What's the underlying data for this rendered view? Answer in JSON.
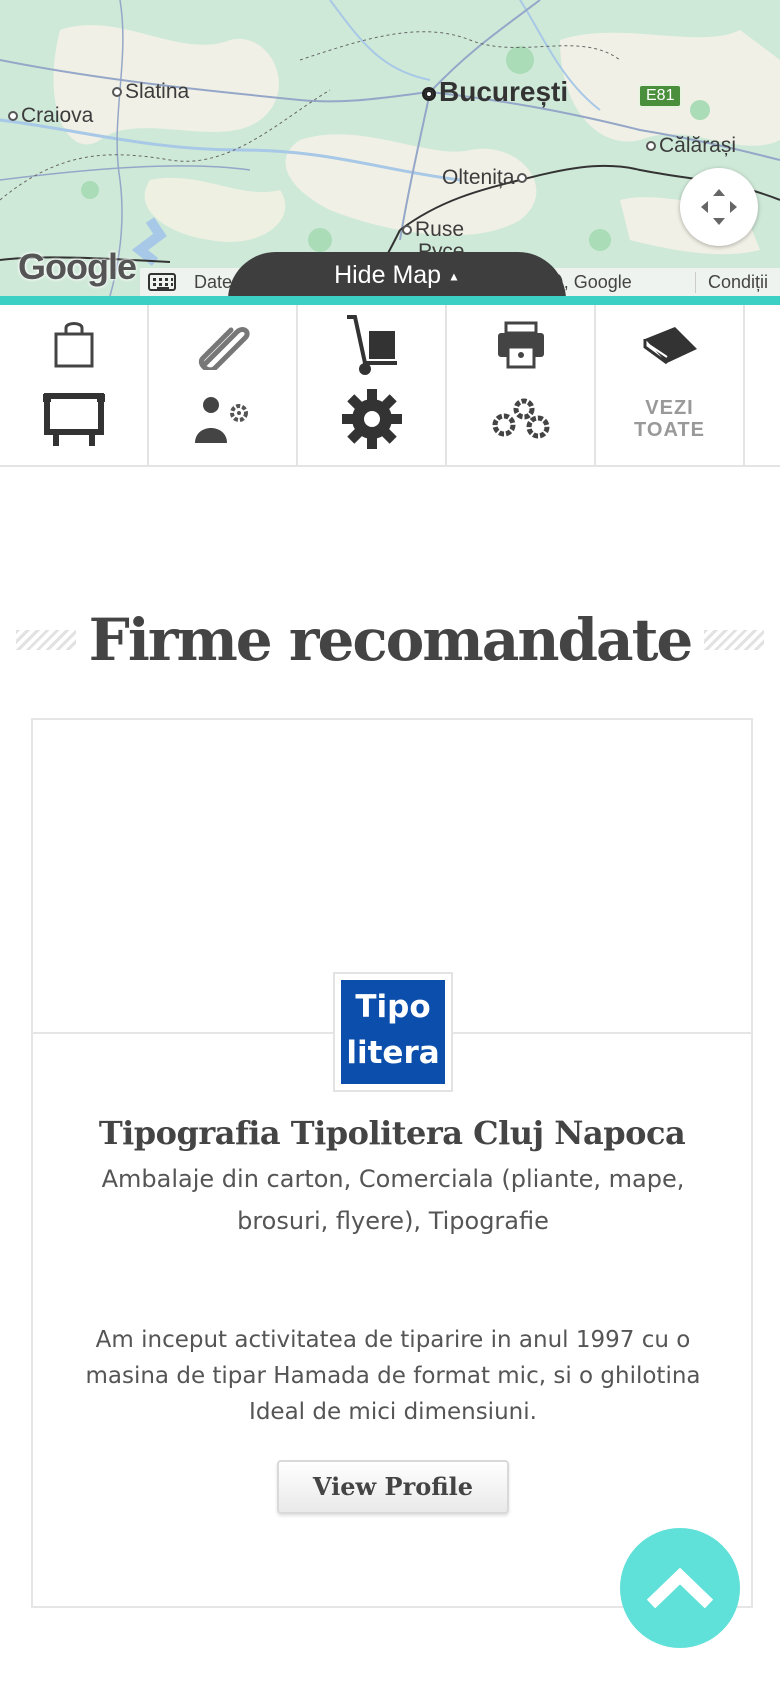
{
  "map": {
    "cities": {
      "bucuresti": "București",
      "slatina": "Slatina",
      "craiova": "Craiova",
      "calarasi": "Călărași",
      "oltenita": "Oltenița",
      "ruse": "Ruse",
      "ruse_alt": "Русе"
    },
    "road_badge": "E81",
    "google_logo": "Google",
    "attribution": "Date hartă ©2025 GeoBasis-DE/BKG (©2009), Google",
    "terms_link": "Condiții",
    "hide_map_label": "Hide Map",
    "colors": {
      "map_bg": "#cfe9d8",
      "accent_teal": "#3ccfc4"
    }
  },
  "categories": {
    "icons_top": [
      "shopping-bag-icon",
      "paperclip-icon",
      "hand-truck-icon",
      "printer-icon",
      "book-icon"
    ],
    "icons_bottom": [
      "billboard-icon",
      "consultant-icon",
      "gear-icon",
      "gears-icon"
    ],
    "view_all_line1": "VEZI",
    "view_all_line2": "TOATE"
  },
  "section": {
    "title": "Firme recomandate"
  },
  "listing": {
    "logo_line1": "Tipo",
    "logo_line2": "litera",
    "logo_color": "#0c4eab",
    "name": "Tipografia Tipolitera Cluj Napoca",
    "categories": "Ambalaje din carton, Comerciala (pliante, mape, brosuri, flyere), Tipografie",
    "description": "Am inceput activitatea de tiparire in anul 1997 cu o masina de tipar Hamada de format mic, si o ghilotina Ideal de mici dimensiuni.",
    "cta": "View Profile"
  },
  "scroll_top": {
    "color": "#5fe0d8"
  }
}
